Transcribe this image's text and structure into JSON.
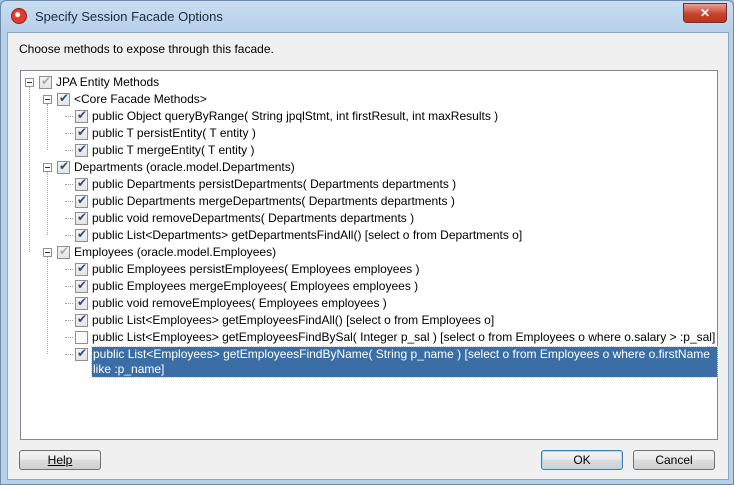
{
  "window": {
    "title": "Specify Session Facade Options",
    "close_label": "✕"
  },
  "prompt": "Choose methods to expose through this facade.",
  "tree": {
    "root": {
      "label": "JPA Entity Methods",
      "state": "partial"
    },
    "groups": [
      {
        "label": "<Core Facade Methods>",
        "state": "checked",
        "items": [
          {
            "label": "public Object queryByRange( String jpqlStmt, int firstResult, int maxResults )",
            "state": "checked"
          },
          {
            "label": "public T persistEntity( T entity )",
            "state": "checked"
          },
          {
            "label": "public T mergeEntity( T entity )",
            "state": "checked"
          }
        ]
      },
      {
        "label": "Departments (oracle.model.Departments)",
        "state": "checked",
        "items": [
          {
            "label": "public Departments persistDepartments( Departments departments )",
            "state": "checked"
          },
          {
            "label": "public Departments mergeDepartments( Departments departments )",
            "state": "checked"
          },
          {
            "label": "public void removeDepartments( Departments departments )",
            "state": "checked"
          },
          {
            "label": "public List<Departments> getDepartmentsFindAll() [select o from Departments o]",
            "state": "checked"
          }
        ]
      },
      {
        "label": "Employees (oracle.model.Employees)",
        "state": "partial",
        "items": [
          {
            "label": "public Employees persistEmployees( Employees employees )",
            "state": "checked"
          },
          {
            "label": "public Employees mergeEmployees( Employees employees )",
            "state": "checked"
          },
          {
            "label": "public void removeEmployees( Employees employees )",
            "state": "checked"
          },
          {
            "label": "public List<Employees> getEmployeesFindAll() [select o from Employees o]",
            "state": "checked"
          },
          {
            "label": "public List<Employees> getEmployeesFindBySal( Integer p_sal ) [select o from Employees o where o.salary > :p_sal]",
            "state": "unchecked"
          },
          {
            "label": "public List<Employees> getEmployeesFindByName( String p_name ) [select o from Employees o where o.firstName like :p_name]",
            "state": "checked",
            "selected": true
          }
        ]
      }
    ]
  },
  "buttons": {
    "help": "Help",
    "ok": "OK",
    "cancel": "Cancel"
  }
}
